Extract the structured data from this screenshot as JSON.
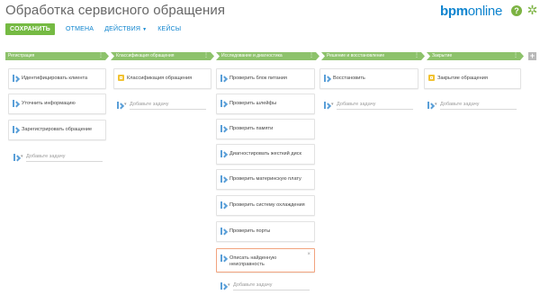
{
  "header": {
    "title": "Обработка сервисного обращения",
    "brand_bold": "bpm",
    "brand_light": "online",
    "help_glyph": "?"
  },
  "toolbar": {
    "save_label": "СОХРАНИТЬ",
    "cancel_label": "ОТМЕНА",
    "actions_label": "ДЕЙСТВИЯ",
    "cases_label": "КЕЙСЫ"
  },
  "stages": [
    {
      "label": "Регистрация"
    },
    {
      "label": "Классификация обращения"
    },
    {
      "label": "Исследование и диагностика"
    },
    {
      "label": "Решение и восстановление"
    },
    {
      "label": "Закрытие"
    }
  ],
  "stage_add_label": "+",
  "add_task_label": "Добавьте задачу",
  "columns": [
    {
      "cards": [
        {
          "label": "Идентифицировать клиента",
          "icon": "user-task-icon"
        },
        {
          "label": "Уточнить информацию",
          "icon": "user-task-icon"
        },
        {
          "label": "Зарегистрировать обращение",
          "icon": "user-task-icon"
        }
      ]
    },
    {
      "cards": [
        {
          "label": "Классификация обращения",
          "icon": "automated-task-icon"
        }
      ]
    },
    {
      "cards": [
        {
          "label": "Проверить блок питания",
          "icon": "user-task-icon"
        },
        {
          "label": "Проверить шлейфы",
          "icon": "user-task-icon"
        },
        {
          "label": "Проверить памяти",
          "icon": "user-task-icon"
        },
        {
          "label": "Диагностировать жесткий диск",
          "icon": "user-task-icon"
        },
        {
          "label": "Проверить материнскую плату",
          "icon": "user-task-icon"
        },
        {
          "label": "Проверить систему охлаждения",
          "icon": "user-task-icon"
        },
        {
          "label": "Проверить порты",
          "icon": "user-task-icon"
        },
        {
          "label": "Описать найденную неисправность",
          "icon": "user-task-icon",
          "selected": true
        }
      ]
    },
    {
      "cards": [
        {
          "label": "Восстановить",
          "icon": "user-task-icon"
        }
      ]
    },
    {
      "cards": [
        {
          "label": "Закрытие обращения",
          "icon": "automated-task-icon"
        }
      ]
    }
  ],
  "colors": {
    "accent_green": "#75ba43",
    "stage_green": "#8dc26b",
    "link_blue": "#0e84cf",
    "selected_border": "#f2a37e"
  }
}
